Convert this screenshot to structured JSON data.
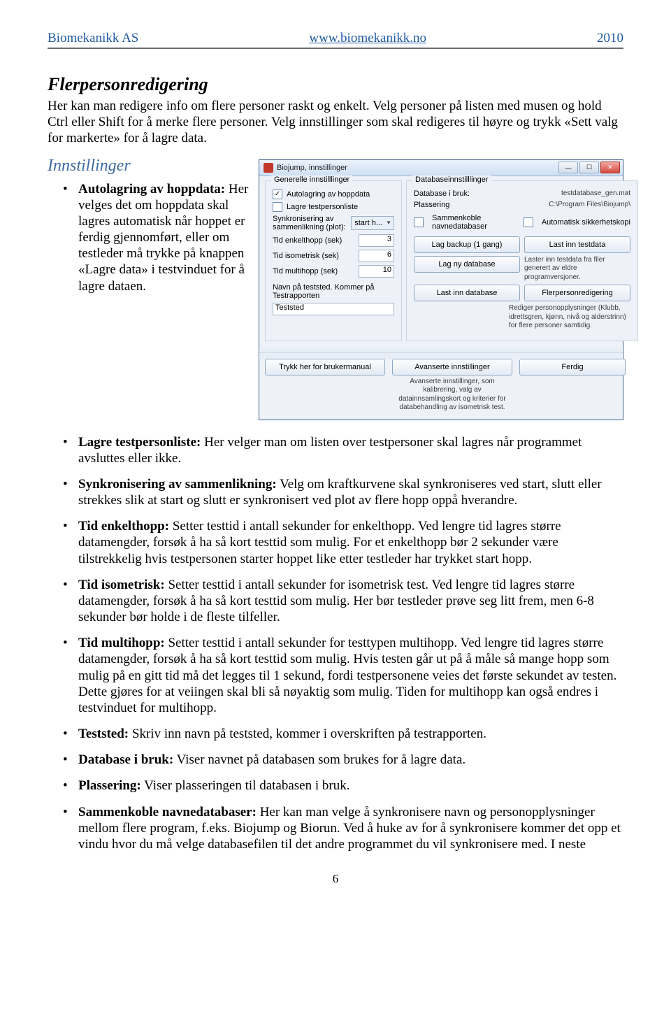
{
  "header": {
    "company": "Biomekanikk AS",
    "url": "www.biomekanikk.no",
    "year": "2010"
  },
  "doc": {
    "h2": "Flerpersonredigering",
    "p_intro": "Her kan man redigere info om flere personer raskt og enkelt. Velg personer på listen med musen og hold Ctrl eller Shift for å merke flere personer. Velg innstillinger som skal redigeres til høyre og trykk «Sett valg for markerte» for å lagre data.",
    "h3": "Innstillinger",
    "left_bullet_lead": "Autolagring av hoppdata:",
    "left_bullet_body": " Her velges det om hoppdata skal lagres automatisk når hoppet er ferdig gjennomført, eller om testleder må trykke på knappen «Lagre data» i testvinduet for å lagre dataen.",
    "bullets": [
      {
        "lead": "Lagre testpersonliste:",
        "body": " Her velger man om listen over testpersoner skal lagres når programmet avsluttes eller ikke."
      },
      {
        "lead": "Synkronisering av sammenlikning:",
        "body": " Velg om kraftkurvene skal synkroniseres ved start, slutt eller strekkes slik at start og slutt er synkronisert ved plot av flere hopp oppå hverandre."
      },
      {
        "lead": "Tid enkelthopp:",
        "body": " Setter testtid i antall sekunder for enkelthopp. Ved lengre tid lagres større datamengder, forsøk å ha så kort testtid som mulig. For et enkelthopp bør 2 sekunder være tilstrekkelig hvis testpersonen starter hoppet like etter testleder har trykket start hopp."
      },
      {
        "lead": "Tid isometrisk:",
        "body": " Setter testtid i antall sekunder for isometrisk test. Ved lengre tid lagres større datamengder, forsøk å ha så kort testtid som mulig. Her bør testleder prøve seg litt frem, men 6-8 sekunder bør holde i de fleste tilfeller."
      },
      {
        "lead": "Tid multihopp:",
        "body": " Setter testtid i antall sekunder for testtypen multihopp. Ved lengre tid lagres større datamengder, forsøk å ha så kort testtid som mulig. Hvis testen går ut på å måle så mange hopp som mulig på en gitt tid må det legges til 1 sekund, fordi testpersonene veies det første sekundet av testen. Dette gjøres for at veiingen skal bli så nøyaktig som mulig. Tiden for multihopp kan også endres i testvinduet for multihopp."
      },
      {
        "lead": "Teststed:",
        "body": " Skriv inn navn på teststed, kommer i overskriften på testrapporten."
      },
      {
        "lead": "Database i bruk:",
        "body": " Viser navnet på databasen som brukes for å lagre data."
      },
      {
        "lead": "Plassering:",
        "body": " Viser plasseringen til databasen i bruk."
      },
      {
        "lead": "Sammenkoble navnedatabaser:",
        "body": " Her kan man velge å synkronisere navn og personopplysninger mellom flere program, f.eks. Biojump og Biorun. Ved å huke av for å synkronisere kommer det opp et vindu hvor du må velge databasefilen til det andre programmet du vil synkronisere med. I neste"
      }
    ],
    "pagenum": "6"
  },
  "win": {
    "title": "Biojump, innstillinger",
    "left": {
      "legend": "Generelle innstilllinger",
      "chk_autolag": "Autolagring av hoppdata",
      "chk_lagre_liste": "Lagre testpersonliste",
      "sync_label": "Synkronisering av sammenlikning (plot):",
      "sync_value": "start h...",
      "tid_enkelt_label": "Tid enkelthopp (sek)",
      "tid_enkelt_val": "3",
      "tid_iso_label": "Tid isometrisk (sek)",
      "tid_iso_val": "6",
      "tid_multi_label": "Tid multihopp (sek)",
      "tid_multi_val": "10",
      "navn_label": "Navn på teststed. Kommer på Testrapporten",
      "navn_val": "Teststed"
    },
    "right": {
      "legend": "Databaseinnstilllinger",
      "db_label": "Database i bruk:",
      "db_val": "testdatabase_gen.mat",
      "plass_label": "Plassering",
      "plass_val": "C:\\Program Files\\Biojump\\",
      "chk_sammen": "Sammenkoble navnedatabaser",
      "chk_auto_sk": "Automatisk sikkerhetskopi",
      "btn_backup": "Lag backup (1 gang)",
      "btn_last_testdata": "Last inn testdata",
      "last_testdata_note": "Laster inn testdata fra filer generert av eldre programversjoner.",
      "btn_lag_ny": "Lag ny database",
      "btn_last_db": "Last inn database",
      "btn_flerperson": "Flerpersonredigering",
      "flerperson_note": "Rediger personopplysninger (Klubb, idrettsgren, kjønn, nivå og alderstrinn) for flere personer samtidig."
    },
    "bottom": {
      "btn_manual": "Trykk her for brukermanual",
      "btn_adv": "Avanserte innstillinger",
      "adv_note": "Avanserte innstillinger, som kalibrering, valg av datainnsamlingskort og kriterier for databehandling av isometrisk test.",
      "btn_ferdig": "Ferdig"
    }
  }
}
